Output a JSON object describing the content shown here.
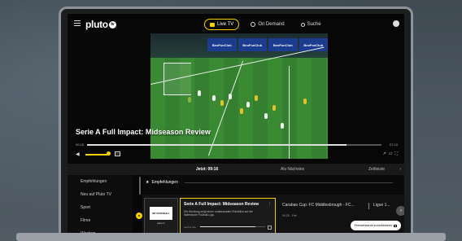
{
  "app": {
    "logo_text": "pluto",
    "logo_badge": "tv"
  },
  "nav": {
    "tabs": [
      {
        "label": "Live TV",
        "active": true
      },
      {
        "label": "On Demand",
        "active": false
      },
      {
        "label": "Suche",
        "active": false
      }
    ]
  },
  "player": {
    "title": "Serie A Full Impact: Midseason Review",
    "time_elapsed": "00:15",
    "time_total": "07:10",
    "progress": 0.88,
    "volume": 0.9,
    "ads": [
      "BeoFonClub",
      "BeoFonClub",
      "BeoFonClub",
      "BeoFonClub"
    ]
  },
  "guide": {
    "now_label": "Jetzt: 09:16",
    "next_label": "Als Nächstes",
    "period_label": "Zeitleiste",
    "categories": [
      "Empfehlungen",
      "Neu auf Pluto TV",
      "Sport",
      "Filme",
      "Western"
    ],
    "section_title": "Empfehlungen",
    "channel": {
      "badge": "MY FOOTBALL",
      "name": "pluto tv"
    },
    "now_program": {
      "title": "Serie A Full Impact: Midseason Review",
      "description": "Die Sendung zeigt einen umfassenden Rückblick auf die Italienische Fußball-Liga.",
      "meta": "noch 6 min",
      "progress": 0.85
    },
    "next_program": {
      "title": "Carabao Cup: FC Middlesbrough - FC...",
      "time": "09:25 - Frei"
    },
    "next_program_2": {
      "title": "Ligue 1..."
    },
    "cta_label": "Fernsehkanal zurücksetzen"
  },
  "colors": {
    "accent": "#f5d000",
    "background": "#070707"
  }
}
